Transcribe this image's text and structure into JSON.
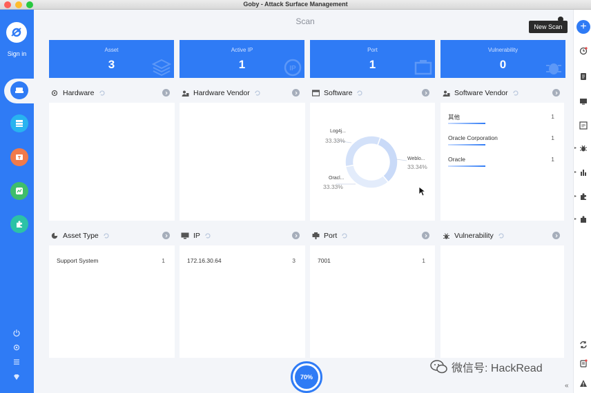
{
  "window": {
    "title": "Goby - Attack Surface Management"
  },
  "sidebar": {
    "signin_label": "Sign in"
  },
  "header": {
    "title": "Scan",
    "tooltip": "New Scan"
  },
  "stats": [
    {
      "label": "Asset",
      "value": "3"
    },
    {
      "label": "Active IP",
      "value": "1"
    },
    {
      "label": "Port",
      "value": "1"
    },
    {
      "label": "Vulnerability",
      "value": "0"
    }
  ],
  "panels": {
    "hardware": {
      "title": "Hardware"
    },
    "hardware_vendor": {
      "title": "Hardware Vendor"
    },
    "software": {
      "title": "Software",
      "donut": [
        {
          "label": "Log4j...",
          "pct": "33.33%",
          "value": 33.33
        },
        {
          "label": "Weblo...",
          "pct": "33.34%",
          "value": 33.34
        },
        {
          "label": "Oracl...",
          "pct": "33.33%",
          "value": 33.33
        }
      ]
    },
    "software_vendor": {
      "title": "Software Vendor",
      "rows": [
        {
          "name": "其他",
          "count": "1"
        },
        {
          "name": "Oracle Corporation",
          "count": "1"
        },
        {
          "name": "Oracle",
          "count": "1"
        }
      ]
    },
    "asset_type": {
      "title": "Asset Type",
      "rows": [
        {
          "name": "Support System",
          "count": "1"
        }
      ]
    },
    "ip": {
      "title": "IP",
      "rows": [
        {
          "name": "172.16.30.64",
          "count": "3"
        }
      ]
    },
    "port": {
      "title": "Port",
      "rows": [
        {
          "name": "7001",
          "count": "1"
        }
      ]
    },
    "vulnerability": {
      "title": "Vulnerability"
    }
  },
  "progress": {
    "label": "70%",
    "value": 70
  },
  "watermark": {
    "text": "微信号: HackRead"
  },
  "colors": {
    "accent": "#2f7bf5",
    "background": "#f3f5f9"
  }
}
